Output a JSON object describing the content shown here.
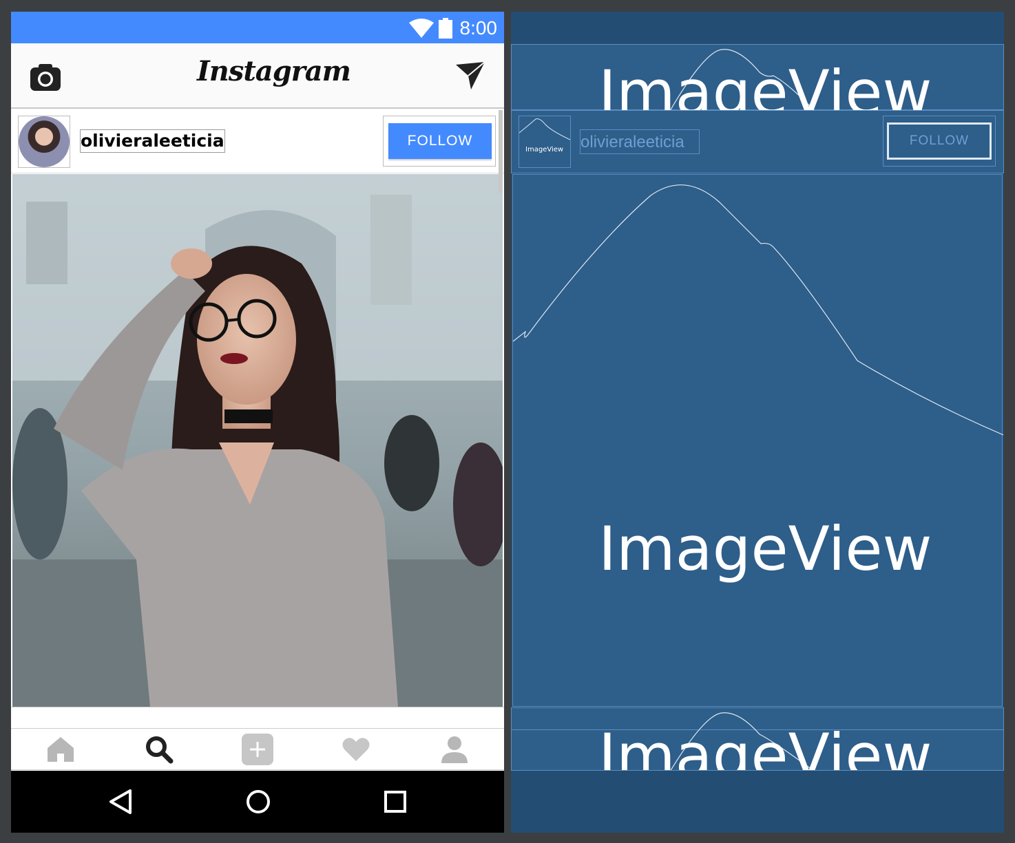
{
  "statusbar": {
    "time": "8:00"
  },
  "topbar": {
    "logo_text": "Instagram",
    "camera_icon": "camera-icon",
    "send_icon": "send-icon"
  },
  "post": {
    "username": "olivieraleeticia",
    "follow_label": "FOLLOW"
  },
  "tabs": [
    {
      "name": "home-icon"
    },
    {
      "name": "search-icon"
    },
    {
      "name": "add-icon"
    },
    {
      "name": "heart-icon"
    },
    {
      "name": "profile-icon"
    }
  ],
  "navbar": [
    "back-icon",
    "home-circle-icon",
    "recents-icon"
  ],
  "blueprint": {
    "header_label": "ImageView",
    "avatar_label": "ImageView",
    "username": "olivieraleeticia",
    "follow_label": "FOLLOW",
    "photo_label": "ImageView",
    "footer_label": "ImageView"
  },
  "colors": {
    "accent": "#448aff",
    "blueprint_bg": "#234d73",
    "blueprint_panel": "#2e5e8a",
    "workspace": "#3c3f41"
  }
}
